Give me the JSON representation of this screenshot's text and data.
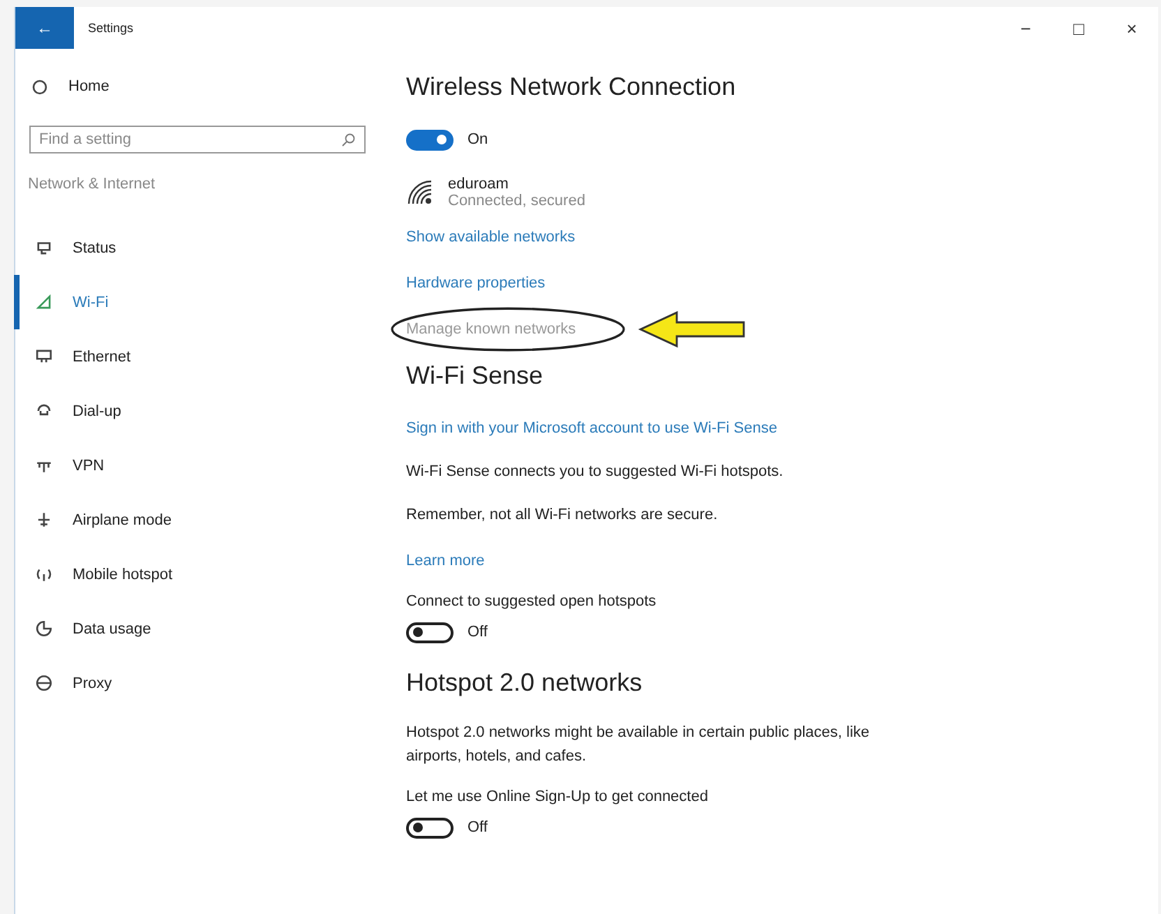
{
  "window": {
    "title": "Settings",
    "back": "←",
    "controls": [
      "−",
      "□",
      "×"
    ]
  },
  "sidebar": {
    "home": "Home",
    "search": {
      "placeholder": "Find a setting"
    },
    "section": "Network & Internet",
    "items": [
      {
        "label": "Status",
        "selected": false
      },
      {
        "label": "Wi-Fi",
        "selected": true
      },
      {
        "label": "Ethernet",
        "selected": false
      },
      {
        "label": "Dial-up",
        "selected": false
      },
      {
        "label": "VPN",
        "selected": false
      },
      {
        "label": "Airplane mode",
        "selected": false
      },
      {
        "label": "Mobile hotspot",
        "selected": false
      },
      {
        "label": "Data usage",
        "selected": false
      },
      {
        "label": "Proxy",
        "selected": false
      }
    ]
  },
  "content": [
    {
      "kind": "heading",
      "text": "Wireless Network Connection"
    },
    {
      "kind": "toggle",
      "on": true,
      "text": "On"
    },
    {
      "kind": "network",
      "name": "eduroam",
      "status": "Connected, secured"
    },
    {
      "kind": "link",
      "text": "Show available networks",
      "disabled": false,
      "circled": false
    },
    {
      "kind": "link",
      "text": "Hardware properties",
      "disabled": false,
      "circled": false
    },
    {
      "kind": "link",
      "text": "Manage known networks",
      "disabled": true,
      "circled": true
    },
    {
      "kind": "heading",
      "text": "Wi-Fi Sense"
    },
    {
      "kind": "link",
      "text": "Sign in with your Microsoft account to use Wi-Fi Sense",
      "disabled": false,
      "circled": false
    },
    {
      "kind": "text",
      "text": "Wi-Fi Sense connects you to suggested Wi-Fi hotspots."
    },
    {
      "kind": "text",
      "text": "Remember, not all Wi-Fi networks are secure."
    },
    {
      "kind": "link",
      "text": "Learn more",
      "disabled": false,
      "circled": false
    },
    {
      "kind": "label",
      "text": "Connect to suggested open hotspots"
    },
    {
      "kind": "toggle",
      "on": false,
      "text": "Off"
    },
    {
      "kind": "heading",
      "text": "Hotspot 2.0 networks"
    },
    {
      "kind": "text",
      "text": "Hotspot 2.0 networks might be available in certain public places, like airports, hotels, and cafes."
    },
    {
      "kind": "label",
      "text": "Let me use Online Sign-Up to get connected"
    },
    {
      "kind": "toggle",
      "on": false,
      "text": "Off"
    }
  ]
}
